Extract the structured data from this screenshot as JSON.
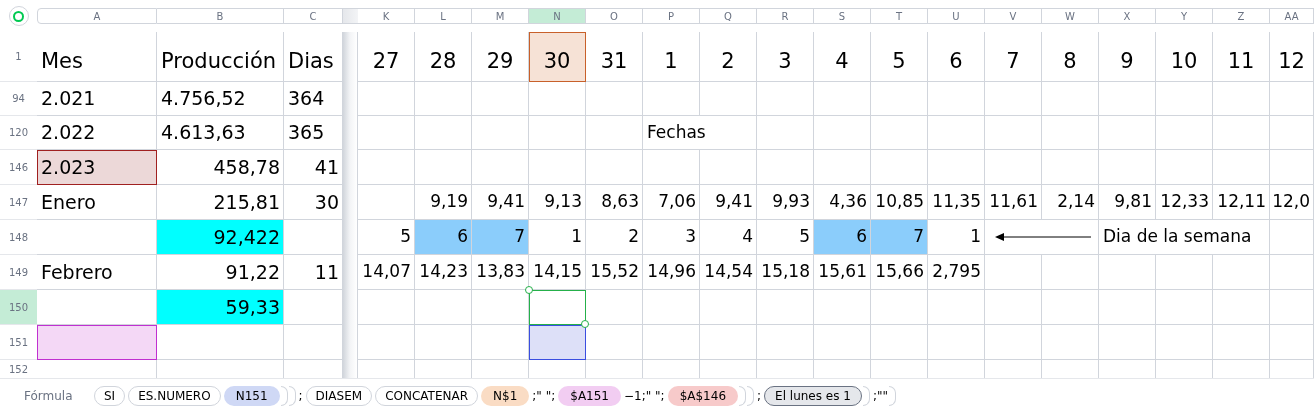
{
  "columns": [
    {
      "letter": "A",
      "selected": false
    },
    {
      "letter": "B",
      "selected": false
    },
    {
      "letter": "C",
      "selected": false
    },
    {
      "letter": "K",
      "selected": false
    },
    {
      "letter": "L",
      "selected": false
    },
    {
      "letter": "M",
      "selected": false
    },
    {
      "letter": "N",
      "selected": true
    },
    {
      "letter": "O",
      "selected": false
    },
    {
      "letter": "P",
      "selected": false
    },
    {
      "letter": "Q",
      "selected": false
    },
    {
      "letter": "R",
      "selected": false
    },
    {
      "letter": "S",
      "selected": false
    },
    {
      "letter": "T",
      "selected": false
    },
    {
      "letter": "U",
      "selected": false
    },
    {
      "letter": "V",
      "selected": false
    },
    {
      "letter": "W",
      "selected": false
    },
    {
      "letter": "X",
      "selected": false
    },
    {
      "letter": "Y",
      "selected": false
    },
    {
      "letter": "Z",
      "selected": false
    },
    {
      "letter": "AA",
      "selected": false
    }
  ],
  "rows": [
    {
      "number": "1",
      "selected": false,
      "cells": [
        {
          "text": "Mes",
          "kind": "text"
        },
        {
          "text": "Producción",
          "kind": "text"
        },
        {
          "text": "Dias",
          "kind": "text"
        },
        {
          "text": "27",
          "kind": "centered"
        },
        {
          "text": "28",
          "kind": "centered"
        },
        {
          "text": "29",
          "kind": "centered"
        },
        {
          "text": "30",
          "kind": "centered",
          "color": "#f6e2d6"
        },
        {
          "text": "31",
          "kind": "centered"
        },
        {
          "text": "1",
          "kind": "centered"
        },
        {
          "text": "2",
          "kind": "centered"
        },
        {
          "text": "3",
          "kind": "centered"
        },
        {
          "text": "4",
          "kind": "centered"
        },
        {
          "text": "5",
          "kind": "centered"
        },
        {
          "text": "6",
          "kind": "centered"
        },
        {
          "text": "7",
          "kind": "centered"
        },
        {
          "text": "8",
          "kind": "centered"
        },
        {
          "text": "9",
          "kind": "centered"
        },
        {
          "text": "10",
          "kind": "centered"
        },
        {
          "text": "11",
          "kind": "centered"
        },
        {
          "text": "12",
          "kind": "centered"
        }
      ]
    },
    {
      "number": "94",
      "selected": false,
      "cells": [
        {
          "text": "2.021",
          "kind": "text"
        },
        {
          "text": "4.756,52",
          "kind": "text"
        },
        {
          "text": "364",
          "kind": "text"
        },
        {},
        {},
        {},
        {},
        {},
        {},
        {},
        {},
        {},
        {},
        {},
        {},
        {},
        {},
        {},
        {},
        {}
      ]
    },
    {
      "number": "120",
      "selected": false,
      "cells": [
        {
          "text": "2.022",
          "kind": "text"
        },
        {
          "text": "4.613,63",
          "kind": "text"
        },
        {
          "text": "365",
          "kind": "text"
        },
        {},
        {},
        {},
        {},
        {},
        {
          "text": "Fechas",
          "kind": "text"
        },
        {},
        {},
        {},
        {},
        {},
        {},
        {},
        {},
        {},
        {},
        {}
      ]
    },
    {
      "number": "146",
      "selected": false,
      "cells": [
        {
          "text": "2.023",
          "kind": "text",
          "color": "#ecd8d8"
        },
        {
          "text": "458,78",
          "kind": "number"
        },
        {
          "text": "41",
          "kind": "number"
        },
        {},
        {},
        {},
        {},
        {},
        {},
        {},
        {},
        {},
        {},
        {},
        {},
        {},
        {},
        {},
        {},
        {}
      ]
    },
    {
      "number": "147",
      "selected": false,
      "cells": [
        {
          "text": "Enero",
          "kind": "text"
        },
        {
          "text": "215,81",
          "kind": "number"
        },
        {
          "text": "30",
          "kind": "number"
        },
        {},
        {
          "text": "9,19",
          "kind": "number"
        },
        {
          "text": "9,41",
          "kind": "number"
        },
        {
          "text": "9,13",
          "kind": "number"
        },
        {
          "text": "8,63",
          "kind": "number"
        },
        {
          "text": "7,06",
          "kind": "number"
        },
        {
          "text": "9,41",
          "kind": "number"
        },
        {
          "text": "9,93",
          "kind": "number"
        },
        {
          "text": "4,36",
          "kind": "number"
        },
        {
          "text": "10,85",
          "kind": "number"
        },
        {
          "text": "11,35",
          "kind": "number"
        },
        {
          "text": "11,61",
          "kind": "number"
        },
        {
          "text": "2,14",
          "kind": "number"
        },
        {
          "text": "9,81",
          "kind": "number"
        },
        {
          "text": "12,33",
          "kind": "number"
        },
        {
          "text": "12,11",
          "kind": "number"
        },
        {
          "text": "12,0",
          "kind": "number"
        }
      ]
    },
    {
      "number": "148",
      "selected": false,
      "cells": [
        {},
        {
          "text": "92,422",
          "kind": "number",
          "color": "#00ffff"
        },
        {},
        {
          "text": "5",
          "kind": "number"
        },
        {
          "text": "6",
          "kind": "number",
          "color": "#8bcdfb"
        },
        {
          "text": "7",
          "kind": "number",
          "color": "#8bcdfb"
        },
        {
          "text": "1",
          "kind": "number"
        },
        {
          "text": "2",
          "kind": "number"
        },
        {
          "text": "3",
          "kind": "number"
        },
        {
          "text": "4",
          "kind": "number"
        },
        {
          "text": "5",
          "kind": "number"
        },
        {
          "text": "6",
          "kind": "number",
          "color": "#8bcdfb"
        },
        {
          "text": "7",
          "kind": "number",
          "color": "#8bcdfb"
        },
        {
          "text": "1",
          "kind": "number"
        },
        {
          "kind": "arrow"
        },
        {},
        {
          "text": "Dia de la semana",
          "kind": "text"
        },
        {},
        {},
        {}
      ]
    },
    {
      "number": "149",
      "selected": false,
      "cells": [
        {
          "text": "Febrero",
          "kind": "text"
        },
        {
          "text": "91,22",
          "kind": "number"
        },
        {
          "text": "11",
          "kind": "number"
        },
        {
          "text": "14,07",
          "kind": "number"
        },
        {
          "text": "14,23",
          "kind": "number"
        },
        {
          "text": "13,83",
          "kind": "number"
        },
        {
          "text": "14,15",
          "kind": "number"
        },
        {
          "text": "15,52",
          "kind": "number"
        },
        {
          "text": "14,96",
          "kind": "number"
        },
        {
          "text": "14,54",
          "kind": "number"
        },
        {
          "text": "15,18",
          "kind": "number"
        },
        {
          "text": "15,61",
          "kind": "number"
        },
        {
          "text": "15,66",
          "kind": "number"
        },
        {
          "text": "2,795",
          "kind": "number"
        },
        {},
        {},
        {},
        {},
        {},
        {}
      ]
    },
    {
      "number": "150",
      "selected": true,
      "cells": [
        {},
        {
          "text": "59,33",
          "kind": "number",
          "color": "#00ffff"
        },
        {},
        {},
        {},
        {},
        {
          "active": true
        },
        {},
        {},
        {},
        {},
        {},
        {},
        {},
        {},
        {},
        {},
        {},
        {},
        {}
      ]
    },
    {
      "number": "151",
      "selected": false,
      "cells": [
        {
          "color": "#f4d8f6"
        },
        {},
        {},
        {},
        {},
        {},
        {
          "color": "#dde0f8"
        },
        {},
        {},
        {},
        {},
        {},
        {},
        {},
        {},
        {},
        {},
        {},
        {},
        {}
      ]
    },
    {
      "number": "152",
      "selected": false,
      "cells": [
        {},
        {},
        {},
        {},
        {},
        {},
        {},
        {},
        {},
        {},
        {},
        {},
        {},
        {},
        {},
        {},
        {},
        {},
        {},
        {}
      ]
    }
  ],
  "formula_bar": {
    "label": "Fórmula",
    "tokens": [
      {
        "kind": "function",
        "text": "SI"
      },
      {
        "kind": "function",
        "text": "ES.NUMERO"
      },
      {
        "kind": "ref",
        "text": "N151",
        "color": "#cfd8f5"
      },
      {
        "kind": "close"
      },
      {
        "kind": "close"
      },
      {
        "kind": "plain",
        "text": ";"
      },
      {
        "kind": "function",
        "text": "DIASEM"
      },
      {
        "kind": "function",
        "text": "CONCATENAR"
      },
      {
        "kind": "ref",
        "text": "N$1",
        "color": "#fadcc4"
      },
      {
        "kind": "plain",
        "text": ";\" \";"
      },
      {
        "kind": "ref",
        "text": "$A151",
        "color": "#f2cdf2"
      },
      {
        "kind": "plain",
        "text": "−1;\" \";"
      },
      {
        "kind": "ref",
        "text": "$A$146",
        "color": "#f7caca"
      },
      {
        "kind": "close"
      },
      {
        "kind": "close"
      },
      {
        "kind": "plain",
        "text": ";"
      },
      {
        "kind": "string",
        "text": "El lunes es 1"
      },
      {
        "kind": "close"
      },
      {
        "kind": "plain",
        "text": ";\"\""
      },
      {
        "kind": "close"
      }
    ]
  }
}
